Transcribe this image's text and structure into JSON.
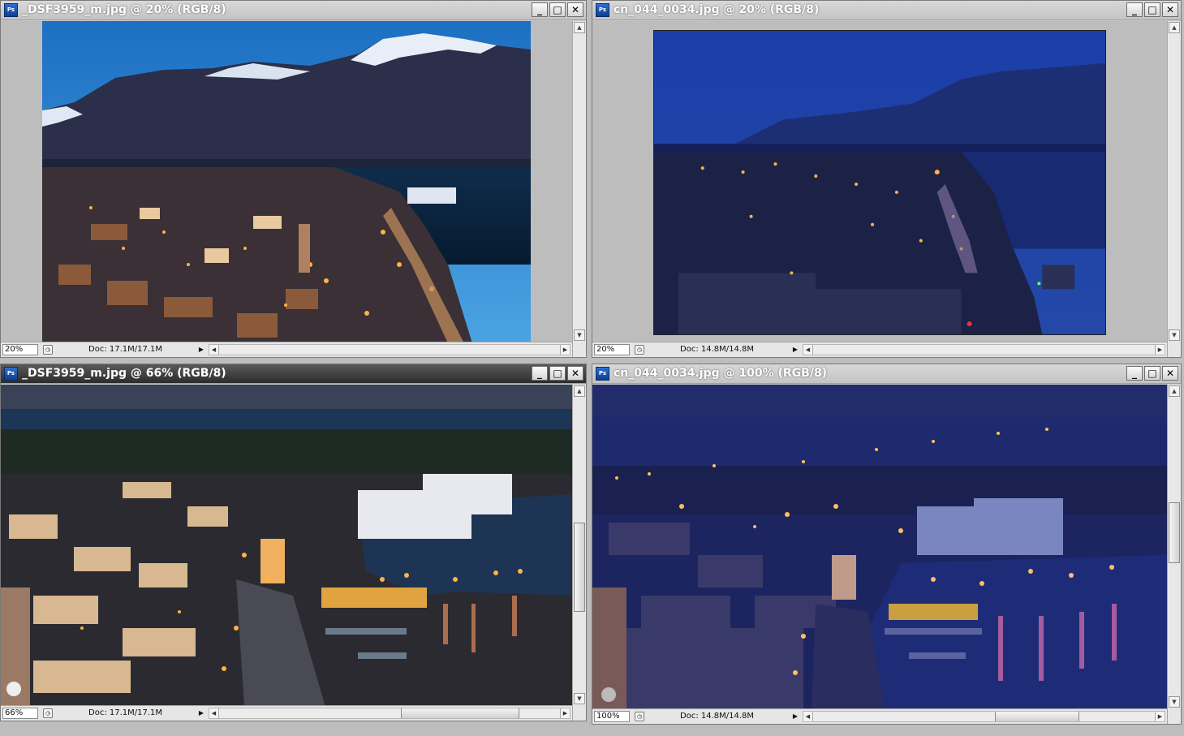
{
  "app": {
    "icon_label": "Ps"
  },
  "windows": [
    {
      "title": "_DSF3959_m.jpg @ 20% (RGB/8)",
      "zoom": "20%",
      "doc": "Doc: 17.1M/17.1M"
    },
    {
      "title": "cn_044_0034.jpg @ 20% (RGB/8)",
      "zoom": "20%",
      "doc": "Doc: 14.8M/14.8M"
    },
    {
      "title": "_DSF3959_m.jpg @ 66% (RGB/8)",
      "zoom": "66%",
      "doc": "Doc: 17.1M/17.1M"
    },
    {
      "title": "cn_044_0034.jpg @ 100% (RGB/8)",
      "zoom": "100%",
      "doc": "Doc: 14.8M/14.8M"
    }
  ],
  "buttons": {
    "minimize": "_",
    "maximize": "□",
    "close": "✕"
  },
  "icons": {
    "status_menu": "▶",
    "scroll_up": "▲",
    "scroll_down": "▼",
    "scroll_left": "◀",
    "scroll_right": "▶",
    "nav": "◷"
  },
  "colors": {
    "active_title": "#3c3c3c",
    "inactive_title": "#c4c4c4"
  }
}
